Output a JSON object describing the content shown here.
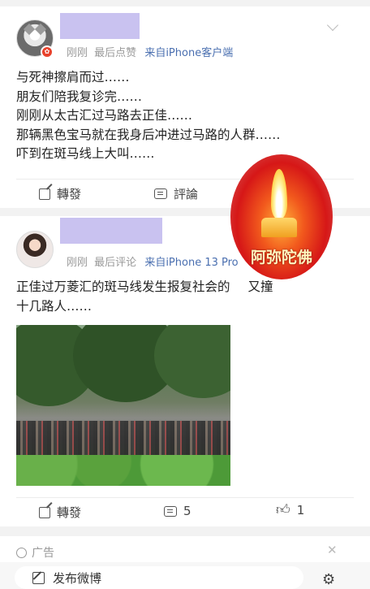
{
  "post1": {
    "meta_time": "刚刚",
    "meta_action": "最后点赞",
    "meta_source": "来自iPhone客户端",
    "lines": [
      "与死神擦肩而过……",
      "朋友们陪我复诊完……",
      "刚刚从太古汇过马路去正佳……",
      "那辆黑色宝马就在我身后冲进过马路的人群……",
      "吓到在斑马线上大叫……"
    ],
    "share_label": "轉發",
    "comment_label": "評論"
  },
  "sticker": {
    "text": "阿弥陀佛"
  },
  "post2": {
    "meta_time": "刚刚",
    "meta_action": "最后评论",
    "meta_source": "来自iPhone 13 Pro",
    "lines": [
      "正佳过万菱汇的斑马线发生报复社会的",
      "十几路人……"
    ],
    "line1_tail": "又撞",
    "share_label": "轉發",
    "comment_count": "5",
    "like_count": "1"
  },
  "ad": {
    "label": "广告"
  },
  "compose": {
    "label": "发布微博"
  },
  "icons": {
    "share": "share-icon",
    "comment": "comment-icon",
    "like": "thumbs-up-icon",
    "more": "chevron-down-icon",
    "ad": "ad-info-icon",
    "close": "close-icon",
    "edit": "edit-icon",
    "settings": "settings-icon"
  },
  "colors": {
    "name_redaction": "#c9c2f0",
    "source_link": "#4a6fb0",
    "badge": "#e8412b"
  }
}
